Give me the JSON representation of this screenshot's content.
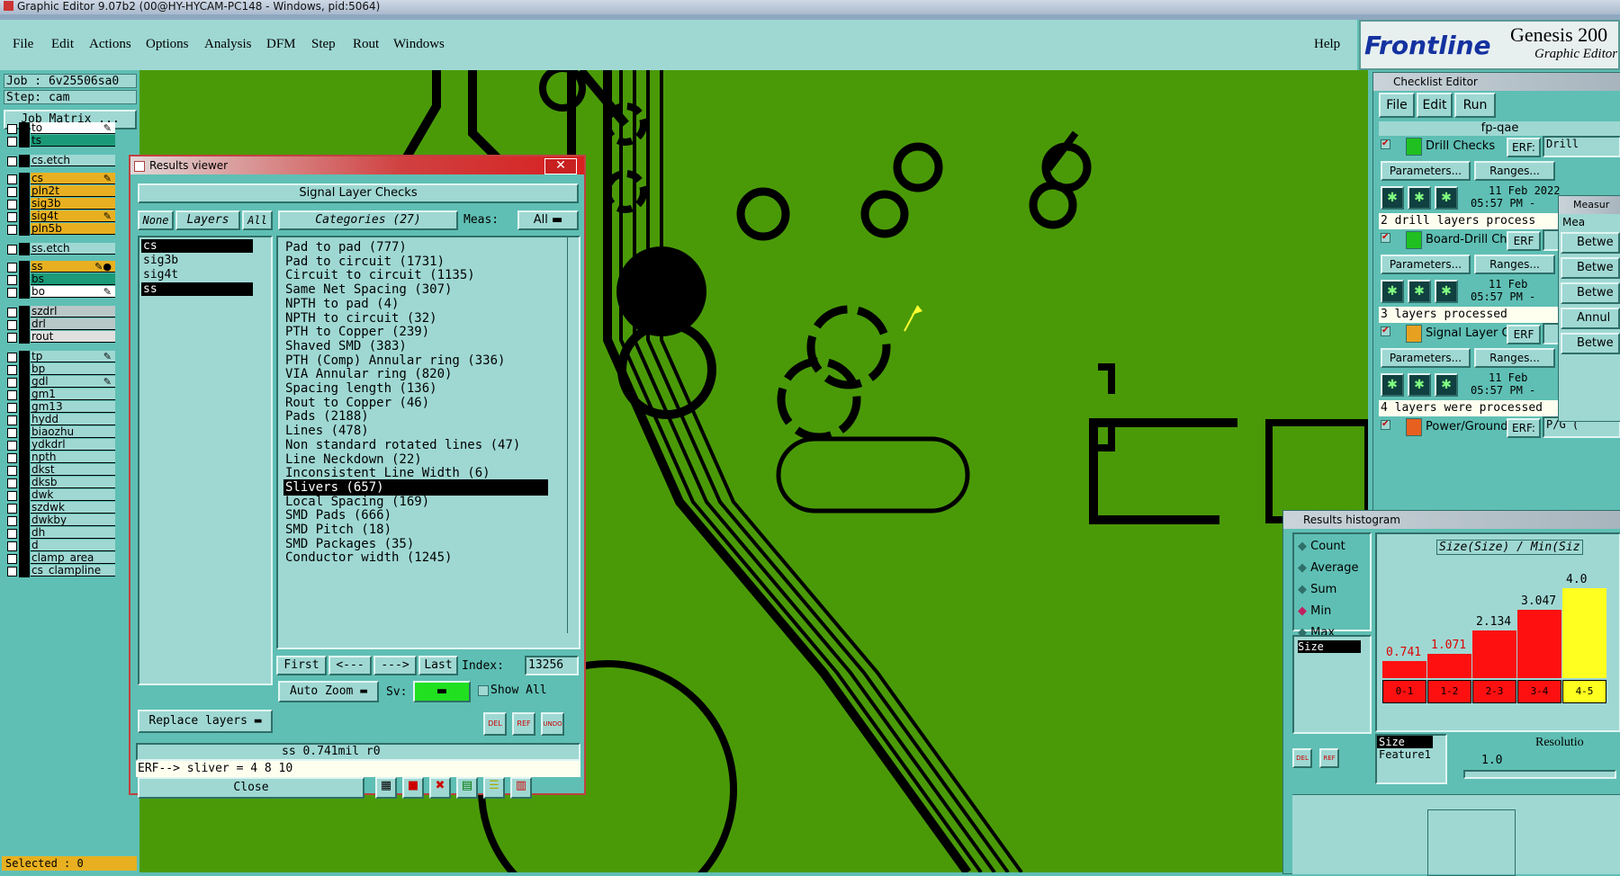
{
  "window": {
    "title": "Graphic Editor 9.07b2 (00@HY-HYCAM-PC148 - Windows, pid:5064)"
  },
  "menu": {
    "items": [
      "File",
      "Edit",
      "Actions",
      "Options",
      "Analysis",
      "DFM",
      "Step",
      "Rout",
      "Windows"
    ],
    "help": "Help"
  },
  "brand": {
    "logo": "Frontline",
    "product": "Genesis 200",
    "subtitle": "Graphic Editor"
  },
  "job": {
    "job_line": "Job : 6v25506sa0",
    "step_line": "Step: cam",
    "matrix_button": "Job Matrix ...",
    "selected": "Selected : 0"
  },
  "layers": [
    {
      "name": "to",
      "color": "#ffffff",
      "mark": "✎"
    },
    {
      "name": "ts",
      "color": "#1a9a78",
      "mark": ""
    },
    {
      "name": "cs.etch",
      "color": "#9fd8d3",
      "mark": ""
    },
    {
      "name": "cs",
      "color": "#e8b020",
      "mark": "✎"
    },
    {
      "name": "pln2t",
      "color": "#e8b020",
      "mark": ""
    },
    {
      "name": "sig3b",
      "color": "#e8b020",
      "mark": ""
    },
    {
      "name": "sig4t",
      "color": "#e8b020",
      "mark": "✎"
    },
    {
      "name": "pln5b",
      "color": "#e8b020",
      "mark": ""
    },
    {
      "name": "ss.etch",
      "color": "#9fd8d3",
      "mark": ""
    },
    {
      "name": "ss",
      "color": "#e8b020",
      "mark": "✎●"
    },
    {
      "name": "bs",
      "color": "#1a9a78",
      "mark": ""
    },
    {
      "name": "bo",
      "color": "#ffffff",
      "mark": "✎"
    },
    {
      "name": "szdrl",
      "color": "#b8c8c8",
      "mark": ""
    },
    {
      "name": "drl",
      "color": "#b8c8c8",
      "mark": ""
    },
    {
      "name": "rout",
      "color": "#e0e0e0",
      "mark": ""
    },
    {
      "name": "tp",
      "color": "#9fd8d3",
      "mark": "✎"
    },
    {
      "name": "bp",
      "color": "#9fd8d3",
      "mark": ""
    },
    {
      "name": "gdl",
      "color": "#9fd8d3",
      "mark": "✎"
    },
    {
      "name": "gm1",
      "color": "#9fd8d3",
      "mark": ""
    },
    {
      "name": "gm13",
      "color": "#9fd8d3",
      "mark": ""
    },
    {
      "name": "hydd",
      "color": "#9fd8d3",
      "mark": ""
    },
    {
      "name": "biaozhu",
      "color": "#9fd8d3",
      "mark": ""
    },
    {
      "name": "ydkdrl",
      "color": "#9fd8d3",
      "mark": ""
    },
    {
      "name": "npth",
      "color": "#9fd8d3",
      "mark": ""
    },
    {
      "name": "dkst",
      "color": "#9fd8d3",
      "mark": ""
    },
    {
      "name": "dksb",
      "color": "#9fd8d3",
      "mark": ""
    },
    {
      "name": "dwk",
      "color": "#9fd8d3",
      "mark": ""
    },
    {
      "name": "szdwk",
      "color": "#9fd8d3",
      "mark": ""
    },
    {
      "name": "dwkby",
      "color": "#9fd8d3",
      "mark": ""
    },
    {
      "name": "dh",
      "color": "#9fd8d3",
      "mark": ""
    },
    {
      "name": "d",
      "color": "#9fd8d3",
      "mark": ""
    },
    {
      "name": "clamp_area",
      "color": "#9fd8d3",
      "mark": ""
    },
    {
      "name": "cs_clampline",
      "color": "#9fd8d3",
      "mark": ""
    }
  ],
  "results_viewer": {
    "title": "Results viewer",
    "header": "Signal Layer Checks",
    "none": "None",
    "layers": "Layers",
    "all": "All",
    "categories": "Categories (27)",
    "meas_label": "Meas:",
    "meas_value": "All",
    "layer_list": [
      "cs",
      "sig3b",
      "sig4t",
      "ss"
    ],
    "category_list": [
      "Pad to pad (777)",
      "Pad to circuit (1731)",
      "Circuit to circuit (1135)",
      "Same Net Spacing (307)",
      "NPTH to pad (4)",
      "NPTH to circuit (32)",
      "PTH to Copper (239)",
      "Shaved SMD (383)",
      "PTH (Comp) Annular ring (336)",
      "VIA Annular ring (820)",
      "Spacing length (136)",
      "Rout to Copper (46)",
      "Pads (2188)",
      "Lines (478)",
      "Non standard rotated lines (47)",
      "Line Neckdown (22)",
      "Inconsistent Line Width (6)",
      "Slivers (657)",
      "Local Spacing (169)",
      "SMD Pads (666)",
      "SMD Pitch (18)",
      "SMD Packages (35)",
      "Conductor width (1245)"
    ],
    "selected_category": "Slivers (657)",
    "first": "First",
    "prev": "<---",
    "next": "--->",
    "last": "Last",
    "index_label": "Index:",
    "index_value": "13256",
    "auto_zoom": "Auto Zoom",
    "sv": "Sv:",
    "show_all": "Show All",
    "replace_layers": "Replace layers",
    "icons": {
      "del": "DEL",
      "ref": "REF",
      "undo": "UNDO"
    },
    "status": "ss 0.741mil  r0",
    "erf": "ERF--> sliver = 4 8 10",
    "close": "Close",
    "colors": {
      "sv_swatch": "#20e020"
    }
  },
  "checklist": {
    "title": "Checklist Editor",
    "menu": [
      "File",
      "Edit",
      "Run"
    ],
    "name": "fp-qae",
    "blocks": [
      {
        "name": "Drill Checks",
        "erf": "ERF:",
        "erf_val": "Drill",
        "date": "11 Feb 2022",
        "time": "05:57 PM -",
        "status": "2 drill layers process"
      },
      {
        "name": "Board-Drill Che",
        "erf": "ERF",
        "erf_val": "",
        "date": "11 Feb",
        "time": "05:57 PM -",
        "status": "3 layers processed"
      },
      {
        "name": "Signal Layer Ch",
        "erf": "ERF",
        "erf_val": "",
        "date": "11 Feb",
        "time": "05:57 PM -",
        "status": "4 layers were processed"
      },
      {
        "name": "Power/Ground C",
        "erf": "ERF:",
        "erf_val": "P/G (",
        "date": "",
        "time": "",
        "status": ""
      }
    ],
    "params": "Parameters...",
    "ranges": "Ranges...",
    "measure": {
      "title": "Measur",
      "head": "Mea",
      "items": [
        "Betwe",
        "Betwe",
        "Betwe",
        "Annul",
        "Betwe"
      ]
    }
  },
  "histogram": {
    "title": "Results histogram",
    "options": [
      "Count",
      "Average",
      "Sum",
      "Min",
      "Max"
    ],
    "selected_option": "Min",
    "list_selected": "Size",
    "formula": "Size(Size) / Min(Siz",
    "bins": [
      "0-1",
      "1-2",
      "2-3",
      "3-4",
      "4-5"
    ],
    "values": [
      0.741,
      1.071,
      2.134,
      3.047,
      4.0
    ],
    "value_labels": [
      "0.741",
      "1.071",
      "2.134",
      "3.047",
      "4.0"
    ],
    "size": "Size",
    "feature": "Feature1",
    "resolution": "Resolutio",
    "res_value": "1.0",
    "del": "DEL",
    "ref": "REF"
  }
}
